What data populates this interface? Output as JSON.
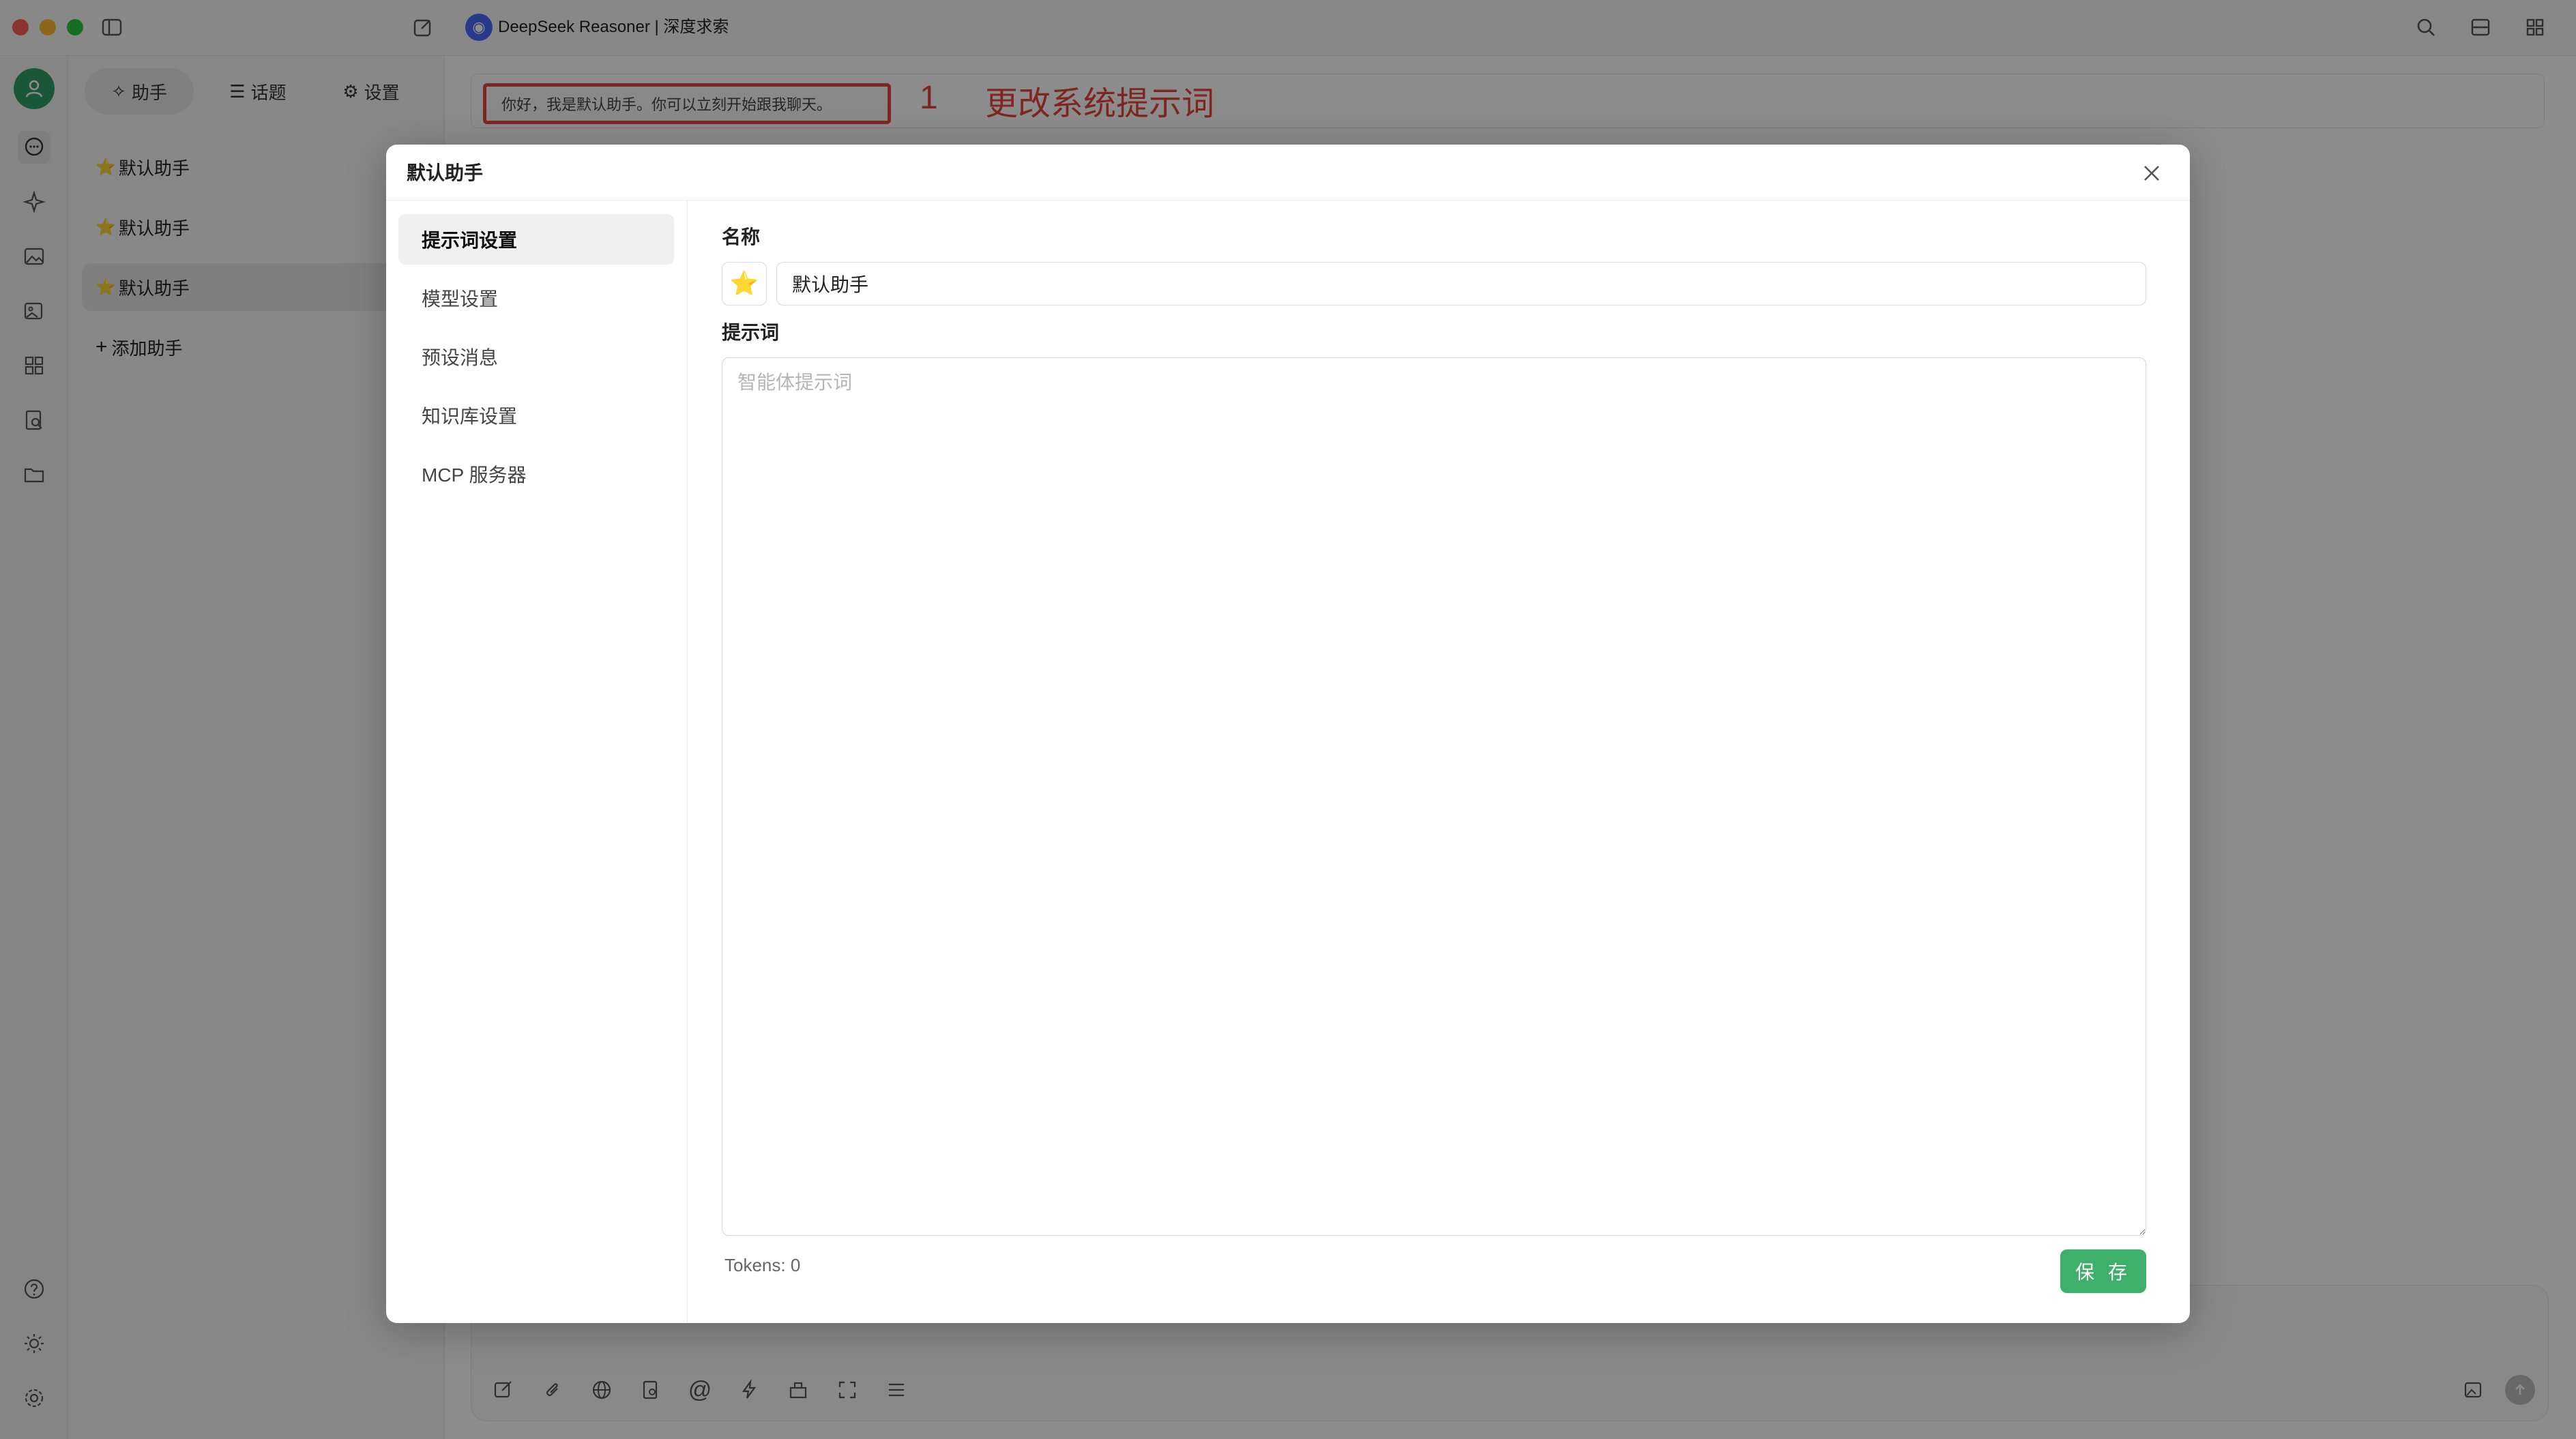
{
  "window": {
    "title": "DeepSeek Reasoner | 深度求索"
  },
  "colors": {
    "accent_green": "#3fb06b",
    "annotation_red": "#e8453c",
    "deepseek_blue": "#4d6bfe"
  },
  "sidebar_tabs": [
    {
      "label": "助手",
      "icon": "sparkle-icon"
    },
    {
      "label": "话题",
      "icon": "list-icon"
    },
    {
      "label": "设置",
      "icon": "gear-icon"
    }
  ],
  "assistants": [
    {
      "emoji": "⭐",
      "name": "默认助手"
    },
    {
      "emoji": "⭐",
      "name": "默认助手"
    },
    {
      "emoji": "⭐",
      "name": "默认助手"
    }
  ],
  "add_assistant_label": "添加助手",
  "main": {
    "system_prompt": "你好，我是默认助手。你可以立刻开始跟我聊天。",
    "annotation_number": "1",
    "annotation_text": "更改系统提示词"
  },
  "modal": {
    "title": "默认助手",
    "nav": [
      "提示词设置",
      "模型设置",
      "预设消息",
      "知识库设置",
      "MCP 服务器"
    ],
    "name_label": "名称",
    "emoji": "⭐",
    "name_value": "默认助手",
    "prompt_label": "提示词",
    "prompt_placeholder": "智能体提示词",
    "tokens_text": "Tokens: 0",
    "save_label": "保 存"
  }
}
